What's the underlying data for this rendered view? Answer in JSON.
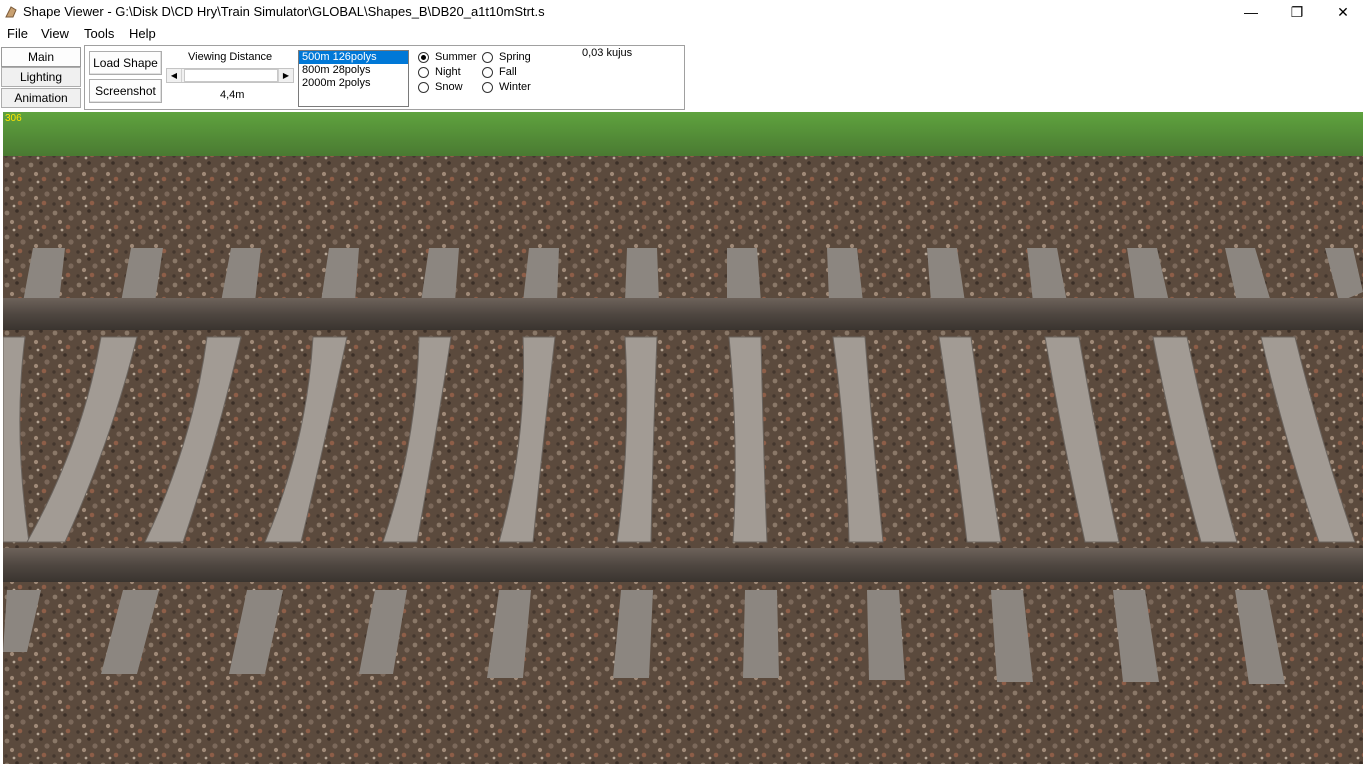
{
  "window": {
    "title": "Shape Viewer - G:\\Disk D\\CD Hry\\Train Simulator\\GLOBAL\\Shapes_B\\DB20_a1t10mStrt.s",
    "controls": {
      "minimize": "—",
      "maximize": "❐",
      "close": "✕"
    }
  },
  "menu": {
    "file": "File",
    "view": "View",
    "tools": "Tools",
    "help": "Help"
  },
  "tabs": {
    "main": "Main",
    "lighting": "Lighting",
    "animation": "Animation"
  },
  "toolbar": {
    "load_shape": "Load Shape",
    "screenshot": "Screenshot",
    "viewing_distance_label": "Viewing Distance",
    "viewing_distance_value": "4,4m",
    "lod_items": [
      "500m 126polys",
      "800m 28polys",
      "2000m 2polys"
    ],
    "selected_lod_index": 0,
    "poly_count": "0,03 kujus"
  },
  "seasons": {
    "summer": "Summer",
    "night": "Night",
    "snow": "Snow",
    "spring": "Spring",
    "fall": "Fall",
    "winter": "Winter",
    "selected": "summer"
  },
  "viewport": {
    "counter": "306"
  },
  "colors": {
    "grass": "#5c9a3c",
    "ballast": "#5b4a3d",
    "sleeper": "#8c8680",
    "rail": "#4f4741",
    "selection": "#0078d7",
    "counter": "#ffe400"
  },
  "icons": {
    "app": "shape-viewer-app-icon"
  }
}
